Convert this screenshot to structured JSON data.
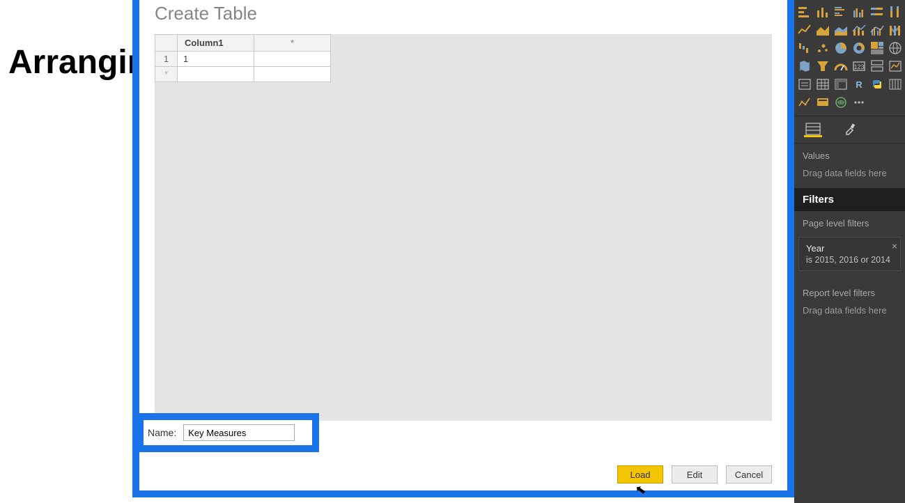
{
  "background": {
    "partial_heading": "Arranging"
  },
  "dialog": {
    "title": "Create Table",
    "grid": {
      "columns": [
        "Column1"
      ],
      "add_col_symbol": "*",
      "rows": [
        {
          "num": "1",
          "cells": [
            "1"
          ]
        },
        {
          "num": "*",
          "cells": [
            ""
          ]
        }
      ]
    },
    "name_label": "Name:",
    "name_value": "Key Measures",
    "buttons": {
      "load": "Load",
      "edit": "Edit",
      "cancel": "Cancel"
    }
  },
  "viz_panel": {
    "values_label": "Values",
    "values_hint": "Drag data fields here",
    "filters_heading": "Filters",
    "page_filters_label": "Page level filters",
    "filter_year": {
      "name": "Year",
      "value": "is 2015, 2016 or 2014"
    },
    "report_filters_label": "Report level filters",
    "report_hint": "Drag data fields here"
  }
}
